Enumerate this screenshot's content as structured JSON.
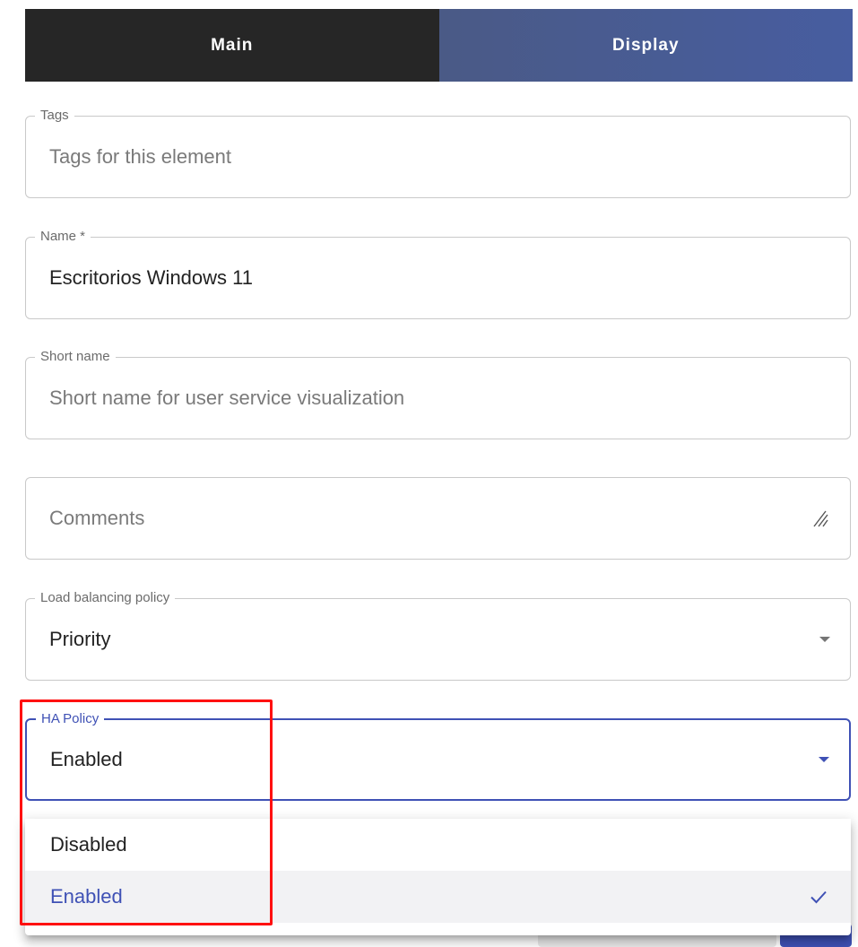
{
  "tabs": [
    {
      "label": "Main"
    },
    {
      "label": "Display"
    }
  ],
  "fields": {
    "tags": {
      "legend": "Tags",
      "placeholder": "Tags for this element"
    },
    "name": {
      "legend": "Name *",
      "value": "Escritorios Windows 11"
    },
    "short_name": {
      "legend": "Short name",
      "placeholder": "Short name for user service visualization"
    },
    "comments": {
      "placeholder": "Comments"
    },
    "load_balancing": {
      "legend": "Load balancing policy",
      "value": "Priority"
    },
    "ha_policy": {
      "legend": "HA Policy",
      "value": "Enabled"
    }
  },
  "dropdown": {
    "options": [
      {
        "label": "Disabled",
        "selected": false
      },
      {
        "label": "Enabled",
        "selected": true
      }
    ]
  },
  "colors": {
    "accent": "#3f51b5",
    "tab_main_bg": "#262626",
    "highlight": "#ff1010"
  },
  "icons": {
    "check": "check-icon",
    "caret": "chevron-down-icon",
    "resize": "resize-handle-icon"
  }
}
